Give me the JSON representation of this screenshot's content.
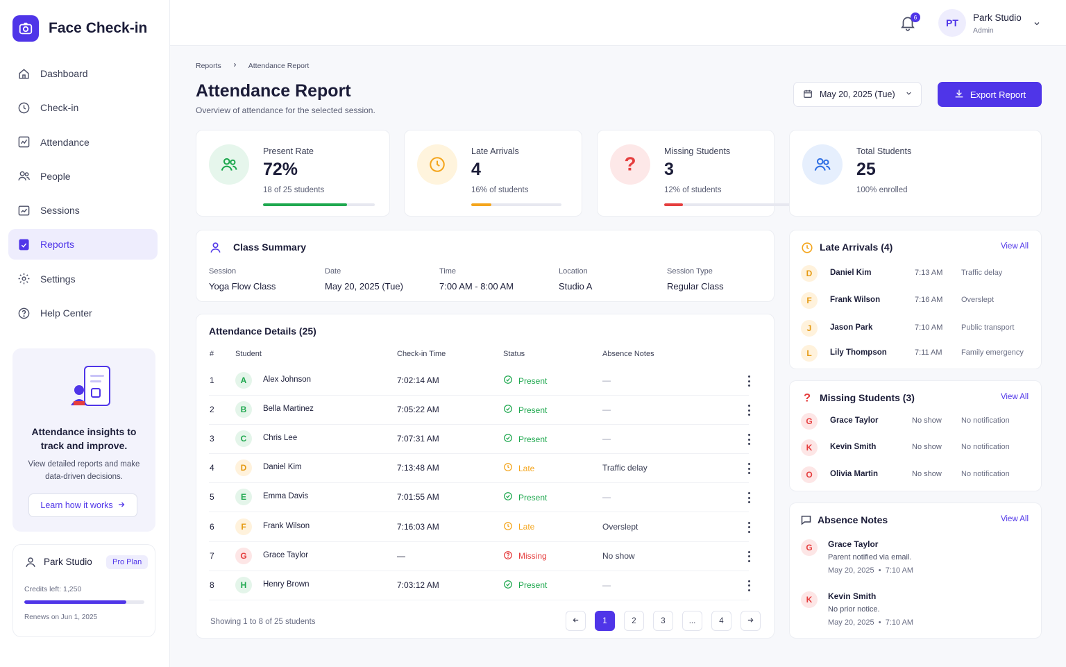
{
  "app": {
    "name": "Face Check-in"
  },
  "nav": [
    {
      "label": "Dashboard",
      "icon": "home-icon",
      "active": false
    },
    {
      "label": "Check-in",
      "icon": "clock-icon",
      "active": false
    },
    {
      "label": "Attendance",
      "icon": "chart-icon",
      "active": false
    },
    {
      "label": "People",
      "icon": "people-icon",
      "active": false
    },
    {
      "label": "Sessions",
      "icon": "sessions-icon",
      "active": false
    },
    {
      "label": "Reports",
      "icon": "report-icon",
      "active": true
    },
    {
      "label": "Settings",
      "icon": "gear-icon",
      "active": false
    },
    {
      "label": "Help Center",
      "icon": "help-icon",
      "active": false
    }
  ],
  "promo": {
    "title": "Attendance insights to track and improve.",
    "text": "View detailed reports and make data-driven decisions.",
    "link": "Learn how it works"
  },
  "plan": {
    "name": "Park Studio",
    "badge": "Pro Plan",
    "credits": "Credits left: 1,250",
    "credits_fraction": 0.85,
    "renew": "Renews on Jun 1, 2025"
  },
  "topbar": {
    "notifications": "6",
    "avatar_initials": "PT",
    "user_name": "Park Studio",
    "user_role": "Admin"
  },
  "breadcrumb": [
    "Reports",
    "Attendance Report"
  ],
  "page": {
    "title": "Attendance Report",
    "subtitle": "Overview of attendance for the selected session.",
    "date": "May 20, 2025 (Tue)",
    "export_label": "Export Report"
  },
  "stats": [
    {
      "label": "Present Rate",
      "value": "72%",
      "sub": "18 of 25 students",
      "progress": 0.75,
      "color": "#1fa84f",
      "bg": "#e6f6ec",
      "icon": "people-icon"
    },
    {
      "label": "Late Arrivals",
      "value": "4",
      "sub": "16% of students",
      "progress": 0.22,
      "color": "#f4a51c",
      "bg": "#fff4dd",
      "icon": "clock-icon"
    },
    {
      "label": "Missing Students",
      "value": "3",
      "sub": "12% of students",
      "progress": 0.13,
      "color": "#e53e3e",
      "bg": "#fde8e8",
      "icon": "question-icon"
    },
    {
      "label": "Total Students",
      "value": "25",
      "sub": "100% enrolled",
      "progress": null,
      "color": "#2f6fe4",
      "bg": "#e6effd",
      "icon": "people-icon"
    }
  ],
  "class_summary": {
    "title": "Class Summary",
    "fields": [
      {
        "label": "Session",
        "value": "Yoga Flow Class"
      },
      {
        "label": "Date",
        "value": "May 20, 2025 (Tue)"
      },
      {
        "label": "Time",
        "value": "7:00 AM - 8:00 AM"
      },
      {
        "label": "Location",
        "value": "Studio A"
      },
      {
        "label": "Session Type",
        "value": "Regular Class"
      }
    ]
  },
  "attendance": {
    "title": "Attendance Details (25)",
    "columns": [
      "#",
      "Student",
      "Check-in Time",
      "Status",
      "Absence Notes"
    ],
    "rows": [
      {
        "n": "1",
        "initial": "A",
        "name": "Alex Johnson",
        "time": "7:02:14 AM",
        "status": "Present",
        "note": "—"
      },
      {
        "n": "2",
        "initial": "B",
        "name": "Bella Martinez",
        "time": "7:05:22 AM",
        "status": "Present",
        "note": "—"
      },
      {
        "n": "3",
        "initial": "C",
        "name": "Chris Lee",
        "time": "7:07:31 AM",
        "status": "Present",
        "note": "—"
      },
      {
        "n": "4",
        "initial": "D",
        "name": "Daniel Kim",
        "time": "7:13:48 AM",
        "status": "Late",
        "note": "Traffic delay"
      },
      {
        "n": "5",
        "initial": "E",
        "name": "Emma Davis",
        "time": "7:01:55 AM",
        "status": "Present",
        "note": "—"
      },
      {
        "n": "6",
        "initial": "F",
        "name": "Frank Wilson",
        "time": "7:16:03 AM",
        "status": "Late",
        "note": "Overslept"
      },
      {
        "n": "7",
        "initial": "G",
        "name": "Grace Taylor",
        "time": "—",
        "status": "Missing",
        "note": "No show"
      },
      {
        "n": "8",
        "initial": "H",
        "name": "Henry Brown",
        "time": "7:03:12 AM",
        "status": "Present",
        "note": "—"
      }
    ],
    "footer": "Showing 1 to 8 of 25 students",
    "pages": [
      "1",
      "2",
      "3",
      "...",
      "4"
    ]
  },
  "late_arrivals": {
    "title": "Late Arrivals (4)",
    "view_all": "View All",
    "items": [
      {
        "initial": "D",
        "name": "Daniel Kim",
        "time": "7:13 AM",
        "note": "Traffic delay"
      },
      {
        "initial": "F",
        "name": "Frank Wilson",
        "time": "7:16 AM",
        "note": "Overslept"
      },
      {
        "initial": "J",
        "name": "Jason Park",
        "time": "7:10 AM",
        "note": "Public transport"
      },
      {
        "initial": "L",
        "name": "Lily Thompson",
        "time": "7:11 AM",
        "note": "Family emergency"
      }
    ]
  },
  "missing_students": {
    "title": "Missing Students (3)",
    "view_all": "View All",
    "items": [
      {
        "initial": "G",
        "name": "Grace Taylor",
        "time": "No show",
        "note": "No notification"
      },
      {
        "initial": "K",
        "name": "Kevin Smith",
        "time": "No show",
        "note": "No notification"
      },
      {
        "initial": "O",
        "name": "Olivia Martin",
        "time": "No show",
        "note": "No notification"
      }
    ]
  },
  "absence_notes": {
    "title": "Absence Notes",
    "view_all": "View All",
    "items": [
      {
        "initial": "G",
        "name": "Grace Taylor",
        "text": "Parent notified via email.",
        "date": "May 20, 2025  •  7:10 AM"
      },
      {
        "initial": "K",
        "name": "Kevin Smith",
        "text": "No prior notice.",
        "date": "May 20, 2025  •  7:10 AM"
      }
    ]
  },
  "colors": {
    "accent": "#4f35e8",
    "present": "#1fa84f",
    "late": "#f4a51c",
    "missing": "#e53e3e"
  }
}
